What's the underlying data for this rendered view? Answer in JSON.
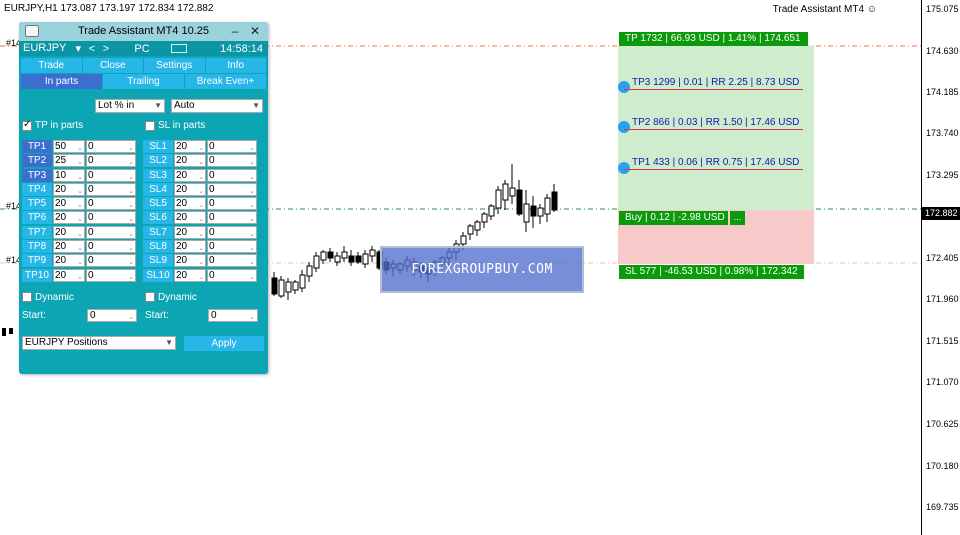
{
  "chart_header": {
    "title": "EURJPY,H1  173.087 173.197 172.834 172.882",
    "expert_label": "Trade Assistant MT4 ☺"
  },
  "price_axis": {
    "ticks": [
      "175.075",
      "174.630",
      "174.185",
      "173.740",
      "173.295",
      "172.405",
      "171.960",
      "171.515",
      "171.070",
      "170.625",
      "170.180",
      "169.735"
    ],
    "current_price": "172.882"
  },
  "edge_labels": [
    "#14",
    "#14",
    "#14"
  ],
  "trade_boxes": {
    "tp_tag": "TP 1732 | 66.93 USD | 1.41% | 174.651",
    "tp3": "TP3 1299 | 0.01 | RR 2.25 | 8.73 USD",
    "tp2": "TP2 866 | 0.03 | RR 1.50 | 17.46 USD",
    "tp1": "TP1 433 | 0.06 | RR 0.75 | 17.46 USD",
    "buy_tag": "Buy | 0.12 | -2.98 USD",
    "buy_more": "...",
    "sl_tag": "SL 577 | -46.53 USD | 0.98% | 172.342",
    "tp_color": "#0a9a0a",
    "tp_zone_color": "#cfeccf",
    "sl_zone_color": "#f8c9c9"
  },
  "watermark": "FOREXGROUPBUY.COM",
  "panel": {
    "title": "Trade Assistant MT4 10.25",
    "minimize": "–",
    "close": "✕",
    "symbol": "EURJPY",
    "symbol_arrow": "▾",
    "prev": "<",
    "next": ">",
    "mode": "PC",
    "time": "14:58:14",
    "tabs_main": [
      "Trade",
      "Close",
      "Settings",
      "Info"
    ],
    "tabs_sub": [
      "In parts",
      "Trailing",
      "Break Even+"
    ],
    "lot_select": "Lot % in",
    "auto_select": "Auto",
    "tp_in_parts": "TP in parts",
    "sl_in_parts": "SL in parts",
    "tp_rows": [
      {
        "label": "TP1",
        "a": "50",
        "b": "0"
      },
      {
        "label": "TP2",
        "a": "25",
        "b": "0"
      },
      {
        "label": "TP3",
        "a": "10",
        "b": "0"
      },
      {
        "label": "TP4",
        "a": "20",
        "b": "0"
      },
      {
        "label": "TP5",
        "a": "20",
        "b": "0"
      },
      {
        "label": "TP6",
        "a": "20",
        "b": "0"
      },
      {
        "label": "TP7",
        "a": "20",
        "b": "0"
      },
      {
        "label": "TP8",
        "a": "20",
        "b": "0"
      },
      {
        "label": "TP9",
        "a": "20",
        "b": "0"
      },
      {
        "label": "TP10",
        "a": "20",
        "b": "0"
      }
    ],
    "sl_rows": [
      {
        "label": "SL1",
        "a": "20",
        "b": "0"
      },
      {
        "label": "SL2",
        "a": "20",
        "b": "0"
      },
      {
        "label": "SL3",
        "a": "20",
        "b": "0"
      },
      {
        "label": "SL4",
        "a": "20",
        "b": "0"
      },
      {
        "label": "SL5",
        "a": "20",
        "b": "0"
      },
      {
        "label": "SL6",
        "a": "20",
        "b": "0"
      },
      {
        "label": "SL7",
        "a": "20",
        "b": "0"
      },
      {
        "label": "SL8",
        "a": "20",
        "b": "0"
      },
      {
        "label": "SL9",
        "a": "20",
        "b": "0"
      },
      {
        "label": "SL10",
        "a": "20",
        "b": "0"
      }
    ],
    "dynamic_left": "Dynamic",
    "dynamic_right": "Dynamic",
    "start_label_left": "Start:",
    "start_label_right": "Start:",
    "start_value_left": "0",
    "start_value_right": "0",
    "positions_select": "EURJPY Positions",
    "apply": "Apply"
  }
}
